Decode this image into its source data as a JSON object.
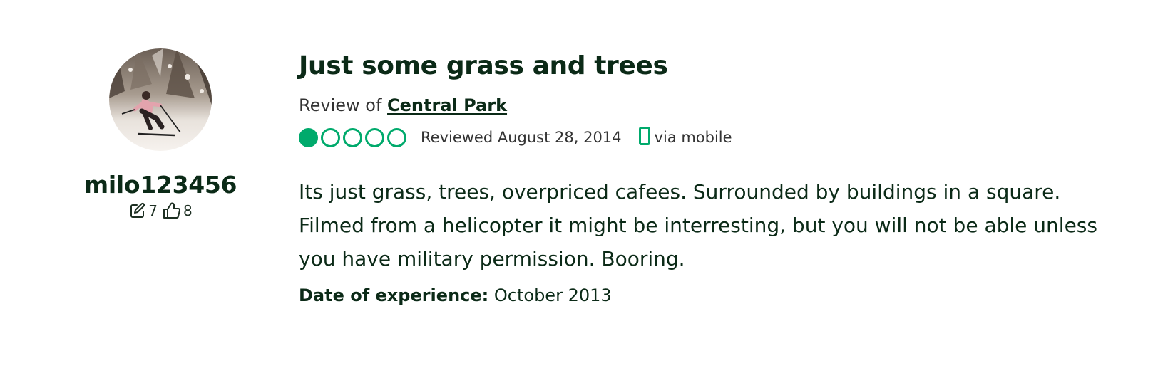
{
  "colors": {
    "accent": "#00aa6c",
    "text_dark": "#0b2a17",
    "text_muted": "#333333"
  },
  "profile": {
    "username": "milo123456",
    "contributions_icon": "pencil-edit-icon",
    "contributions_count": "7",
    "helpful_icon": "thumbs-up-icon",
    "helpful_votes_count": "8",
    "avatar_description": "skier-photo"
  },
  "review": {
    "title": "Just some grass and trees",
    "review_of_prefix": "Review of",
    "attraction_name": "Central Park",
    "rating": 1,
    "rating_max": 5,
    "reviewed_date": "Reviewed August 28, 2014",
    "mobile_icon": "mobile-phone-icon",
    "via_mobile": "via mobile",
    "text": "Its just grass, trees, overpriced cafees. Surrounded by buildings in a square. Filmed from a helicopter it might be interresting, but you will not be able unless you have military permission. Booring.",
    "date_of_experience_label": "Date of experience:",
    "date_of_experience_value": "October 2013"
  }
}
